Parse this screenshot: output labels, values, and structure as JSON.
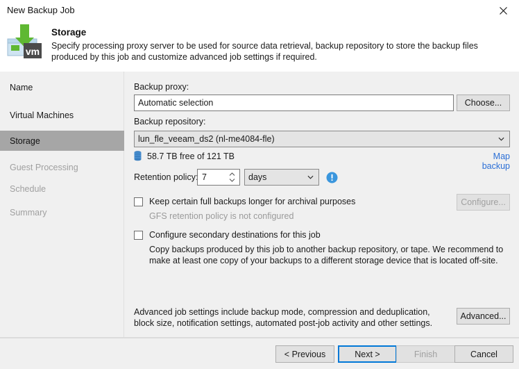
{
  "window": {
    "title": "New Backup Job",
    "close_icon": "close-icon"
  },
  "header": {
    "icon": "vm-backup-icon",
    "title": "Storage",
    "description": "Specify processing proxy server to be used for source data retrieval, backup repository to store the backup files produced by this job and customize advanced job settings if required."
  },
  "sidebar": {
    "items": [
      {
        "label": "Name",
        "state": "normal"
      },
      {
        "label": "Virtual Machines",
        "state": "normal"
      },
      {
        "label": "Storage",
        "state": "selected"
      },
      {
        "label": "Guest Processing",
        "state": "disabled"
      },
      {
        "label": "Schedule",
        "state": "disabled"
      },
      {
        "label": "Summary",
        "state": "disabled"
      }
    ]
  },
  "main": {
    "backup_proxy": {
      "label": "Backup proxy:",
      "value": "Automatic selection",
      "choose_label": "Choose..."
    },
    "backup_repository": {
      "label": "Backup repository:",
      "value": "lun_fle_veeam_ds2 (nl-me4084-fle)",
      "free_space": "58.7 TB free of 121 TB",
      "free_space_icon": "database-icon",
      "map_backup_link": "Map backup"
    },
    "retention": {
      "label": "Retention policy:",
      "count": "7",
      "unit": "days",
      "info_icon": "info-icon"
    },
    "gfs": {
      "checkbox_label": "Keep certain full backups longer for archival purposes",
      "checked": false,
      "status_text": "GFS retention policy is not configured",
      "configure_label": "Configure...",
      "configure_enabled": false
    },
    "secondary": {
      "checkbox_label": "Configure secondary destinations for this job",
      "checked": false,
      "description": "Copy backups produced by this job to another backup repository, or tape. We recommend to make at least one copy of your backups to a different storage device that is located off-site."
    },
    "advanced": {
      "description": "Advanced job settings include backup mode, compression and deduplication, block size, notification settings, automated post-job activity and other settings.",
      "button_label": "Advanced..."
    }
  },
  "footer": {
    "previous_label": "< Previous",
    "next_label": "Next >",
    "finish_label": "Finish",
    "cancel_label": "Cancel",
    "next_focused": true,
    "finish_enabled": false
  },
  "colors": {
    "accent": "#0078d7",
    "link": "#2b6fd6",
    "selected_bg": "#a6a6a6",
    "info_blue": "#3a96dd",
    "arrow_green": "#5fb832",
    "body_bg": "#f0f0f0"
  }
}
